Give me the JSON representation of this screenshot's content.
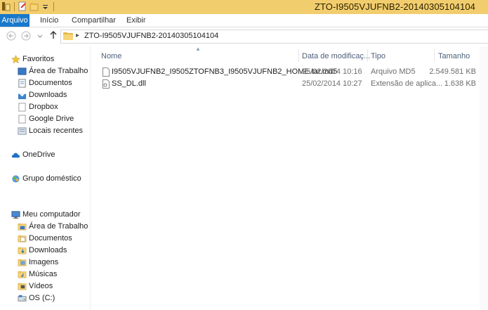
{
  "window": {
    "title": "ZTO-I9505VJUFNB2-20140305104104"
  },
  "ribbon": {
    "tabs": [
      "Arquivo",
      "Início",
      "Compartilhar",
      "Exibir"
    ]
  },
  "address": {
    "path": "ZTO-I9505VJUFNB2-20140305104104"
  },
  "nav": {
    "favorites_label": "Favoritos",
    "favorites": [
      "Área de Trabalho",
      "Documentos",
      "Downloads",
      "Dropbox",
      "Google Drive",
      "Locais recentes"
    ],
    "onedrive_label": "OneDrive",
    "homegroup_label": "Grupo doméstico",
    "computer_label": "Meu computador",
    "computer": [
      "Área de Trabalho",
      "Documentos",
      "Downloads",
      "Imagens",
      "Músicas",
      "Vídeos",
      "OS (C:)"
    ]
  },
  "columns": {
    "name": "Nome",
    "date": "Data de modificaç...",
    "type": "Tipo",
    "size": "Tamanho"
  },
  "files": [
    {
      "name": "I9505VJUFNB2_I9505ZTOFNB3_I9505VJUFNB2_HOME.tar.md5",
      "date": "25/02/2014 10:16",
      "type": "Arquivo MD5",
      "size": "2.549.581 KB"
    },
    {
      "name": "SS_DL.dll",
      "date": "25/02/2014 10:27",
      "type": "Extensão de aplica...",
      "size": "1.638 KB"
    }
  ],
  "icons": {
    "back": "arrow-left-icon",
    "forward": "arrow-right-icon",
    "up": "arrow-up-icon",
    "folder": "folder-icon",
    "star": "star-icon",
    "cloud": "cloud-icon",
    "homegroup": "homegroup-icon",
    "computer": "computer-icon"
  },
  "colors": {
    "titlebar": "#f2cd6e",
    "file_tab": "#1979ca",
    "header_text": "#4c607a"
  }
}
